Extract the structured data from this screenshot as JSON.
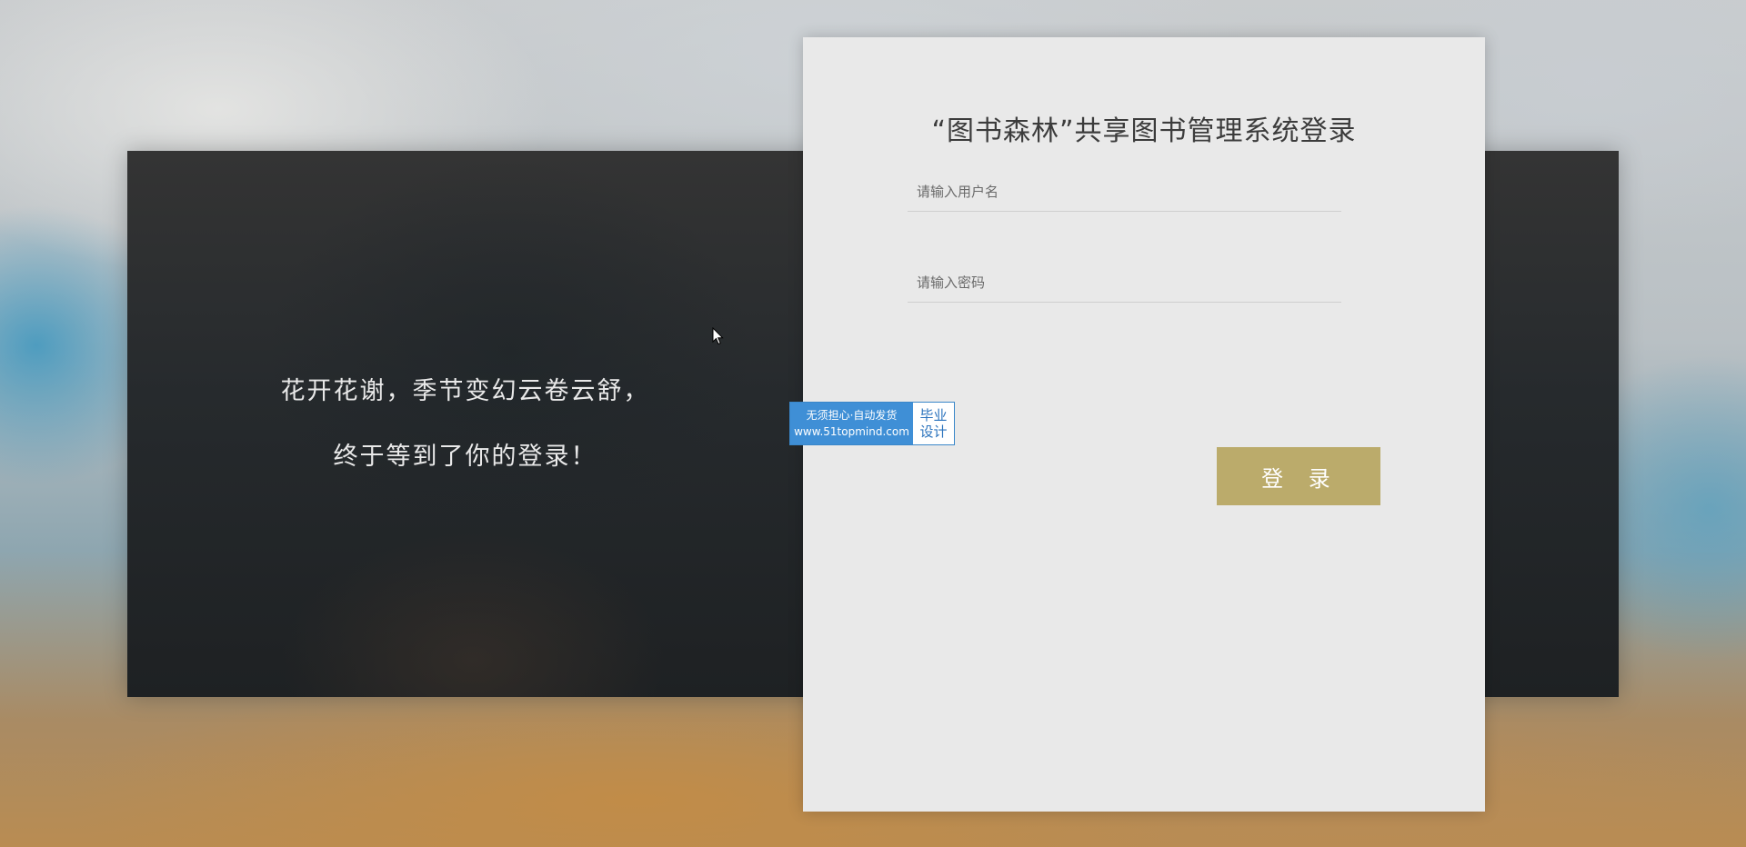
{
  "slogan": {
    "line1": "花开花谢，季节变幻云卷云舒，",
    "line2": "终于等到了你的登录！"
  },
  "login": {
    "title": "“图书森林”共享图书管理系统登录",
    "username_placeholder": "请输入用户名",
    "username_value": "",
    "password_placeholder": "请输入密码",
    "password_value": "",
    "submit_label": "登 录"
  },
  "badge": {
    "tagline": "无须担心·自动发货",
    "url": "www.51topmind.com",
    "right_line1": "毕业",
    "right_line2": "设计"
  },
  "colors": {
    "button": "#bbab6b",
    "card": "#e9e9e9",
    "badge_blue": "#3f8fd6"
  },
  "icons": {
    "cursor": "mouse-pointer-icon"
  }
}
